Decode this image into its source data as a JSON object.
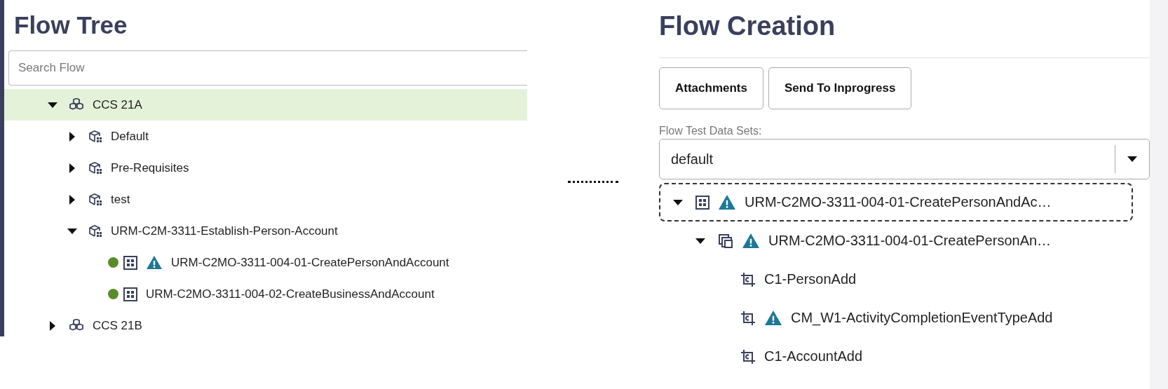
{
  "flow_tree": {
    "title": "Flow Tree",
    "search": {
      "placeholder": "Search Flow"
    },
    "items": [
      {
        "kind": "release",
        "label": "CCS 21A",
        "expanded": true,
        "selected": true,
        "children": [
          {
            "kind": "folder",
            "label": "Default",
            "expanded": false,
            "selected": false
          },
          {
            "kind": "folder",
            "label": "Pre-Requisites",
            "expanded": false,
            "selected": false
          },
          {
            "kind": "folder",
            "label": "test",
            "expanded": false,
            "selected": false
          },
          {
            "kind": "folder",
            "label": "URM-C2M-3311-Establish-Person-Account",
            "expanded": true,
            "selected": false,
            "children": [
              {
                "kind": "flow",
                "label": "URM-C2MO-3311-004-01-CreatePersonAndAccount",
                "color": "#5b8c2a",
                "warning": true,
                "selected": false
              },
              {
                "kind": "flow",
                "label": "URM-C2MO-3311-004-02-CreateBusinessAndAccount",
                "color": "#5b8c2a",
                "warning": false,
                "selected": false
              }
            ]
          }
        ]
      },
      {
        "kind": "release",
        "label": "CCS 21B",
        "expanded": false,
        "selected": false
      }
    ]
  },
  "flow_creation": {
    "title": "Flow Creation",
    "buttons": [
      "Attachments",
      "Send To Inprogress"
    ],
    "data_sets": {
      "label": "Flow Test Data Sets:",
      "value": "default"
    },
    "items": [
      {
        "kind": "flow",
        "label": "URM-C2MO-3311-004-01-CreatePersonAndAc…",
        "warning": true,
        "expanded": true,
        "selected": true,
        "children": [
          {
            "kind": "scenario",
            "label": "URM-C2MO-3311-004-01-CreatePersonAn…",
            "warning": true,
            "expanded": true,
            "selected": false,
            "children": [
              {
                "kind": "component",
                "label": "C1-PersonAdd",
                "warning": false,
                "selected": false
              },
              {
                "kind": "component",
                "label": "CM_W1-ActivityCompletionEventTypeAdd",
                "warning": true,
                "selected": false
              },
              {
                "kind": "component",
                "label": "C1-AccountAdd",
                "warning": false,
                "selected": false
              }
            ]
          }
        ]
      }
    ]
  }
}
